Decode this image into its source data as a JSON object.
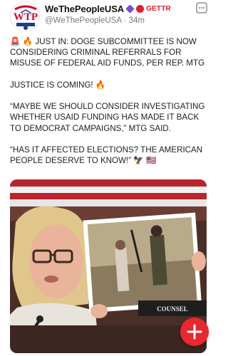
{
  "header": {
    "display_name": "WeThePeopleUSA",
    "platform": "GETTR",
    "handle": "@WeThePeopleUSA",
    "separator": "·",
    "time": "34m"
  },
  "icons": {
    "avatar": "wtp-logo-icon",
    "verified": "verified-badge-icon",
    "status": "red-badge-icon",
    "more": "more-options-icon",
    "compose": "plus-icon"
  },
  "colors": {
    "accent": "#e8282f",
    "verified": "#7b4bd6",
    "text": "#202020",
    "muted": "#7a7a7a"
  },
  "post": {
    "line1_emoji": "🚨 🔥",
    "line1_text": "JUST IN: DOGE SUBCOMMITTEE IS NOW CONSIDERING CRIMINAL REFERRALS FOR MISUSE OF FEDERAL AID FUNDS, PER REP. MTG",
    "line2": "JUSTICE IS COMING! 🔥",
    "line3": "“MAYBE WE SHOULD CONSIDER INVESTIGATING WHETHER USAID FUNDING HAS MADE IT BACK TO DEMOCRAT CAMPAIGNS,” MTG SAID.",
    "line4": "“HAS IT AFFECTED ELECTIONS? THE AMERICAN PEOPLE DESERVE TO KNOW!” 🦅 🇺🇸"
  },
  "media": {
    "placard_text": "COUNSEL"
  }
}
